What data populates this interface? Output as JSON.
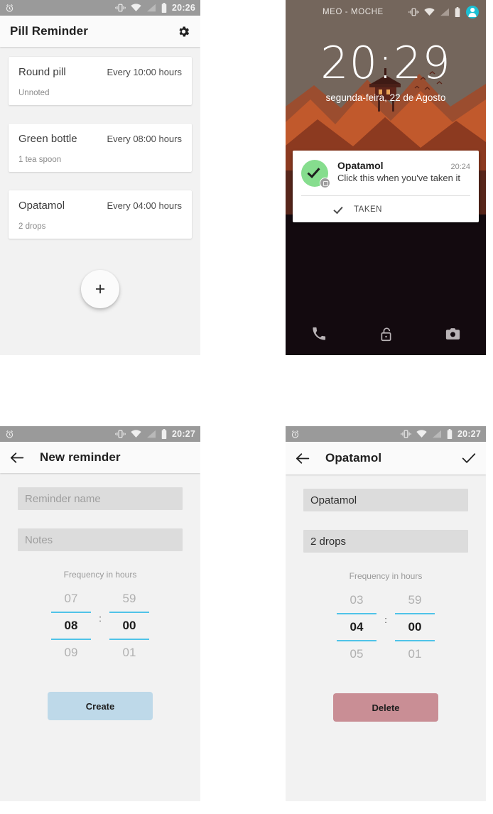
{
  "app": {
    "name": "Pill Reminder"
  },
  "colors": {
    "statusbar": "#9a9a9a",
    "appbar": "#fafafa",
    "background": "#f2f2f2",
    "picker_accent": "#4fc3e8",
    "create_button": "#bed9e9",
    "delete_button": "#c98e95",
    "notification_icon": "#86dd8e",
    "lock_wallpaper_sky": "#74665c",
    "lock_wallpaper_mountain": "#c1592c",
    "avatar": "#1bc0d4"
  },
  "list_screen": {
    "statusbar": {
      "time": "20:26",
      "icons": [
        "alarm-icon",
        "vibrate-icon",
        "wifi-icon",
        "signal-icon",
        "battery-icon"
      ]
    },
    "appbar": {
      "title": "Pill Reminder",
      "action_icon": "gear-icon"
    },
    "reminders": [
      {
        "name": "Round pill",
        "frequency": "Every 10:00 hours",
        "note": "Unnoted"
      },
      {
        "name": "Green bottle",
        "frequency": "Every 08:00 hours",
        "note": "1 tea spoon"
      },
      {
        "name": "Opatamol",
        "frequency": "Every 04:00 hours",
        "note": "2 drops"
      }
    ],
    "fab": {
      "label": "+",
      "icon": "plus-icon"
    }
  },
  "lock_screen": {
    "statusbar": {
      "carrier": "MEO - MOCHE",
      "icons": [
        "vibrate-icon",
        "wifi-icon",
        "signal-icon",
        "battery-icon",
        "user-avatar-icon"
      ]
    },
    "clock": "20:29",
    "date": "segunda-feira, 22 de Agosto",
    "notification": {
      "icon": "check-circle-icon",
      "badge_icon": "alarm-badge-icon",
      "title": "Opatamol",
      "time": "20:24",
      "body": "Click this when you've taken it",
      "action_label": "TAKEN",
      "action_icon": "check-icon"
    },
    "bottom_shortcuts": [
      {
        "name": "phone-icon"
      },
      {
        "name": "unlock-icon"
      },
      {
        "name": "camera-icon"
      }
    ]
  },
  "new_reminder_screen": {
    "statusbar": {
      "time": "20:27"
    },
    "appbar": {
      "back_icon": "back-arrow-icon",
      "title": "New reminder"
    },
    "fields": {
      "name_placeholder": "Reminder name",
      "notes_placeholder": "Notes"
    },
    "picker": {
      "label": "Frequency in hours",
      "hours": {
        "prev": "07",
        "selected": "08",
        "next": "09"
      },
      "separator": ":",
      "minutes": {
        "prev": "59",
        "selected": "00",
        "next": "01"
      }
    },
    "button": {
      "label": "Create"
    }
  },
  "edit_reminder_screen": {
    "statusbar": {
      "time": "20:27"
    },
    "appbar": {
      "back_icon": "back-arrow-icon",
      "title": "Opatamol",
      "action_icon": "check-icon"
    },
    "fields": {
      "name_value": "Opatamol",
      "notes_value": "2 drops"
    },
    "picker": {
      "label": "Frequency in hours",
      "hours": {
        "prev": "03",
        "selected": "04",
        "next": "05"
      },
      "separator": ":",
      "minutes": {
        "prev": "59",
        "selected": "00",
        "next": "01"
      }
    },
    "button": {
      "label": "Delete"
    }
  }
}
